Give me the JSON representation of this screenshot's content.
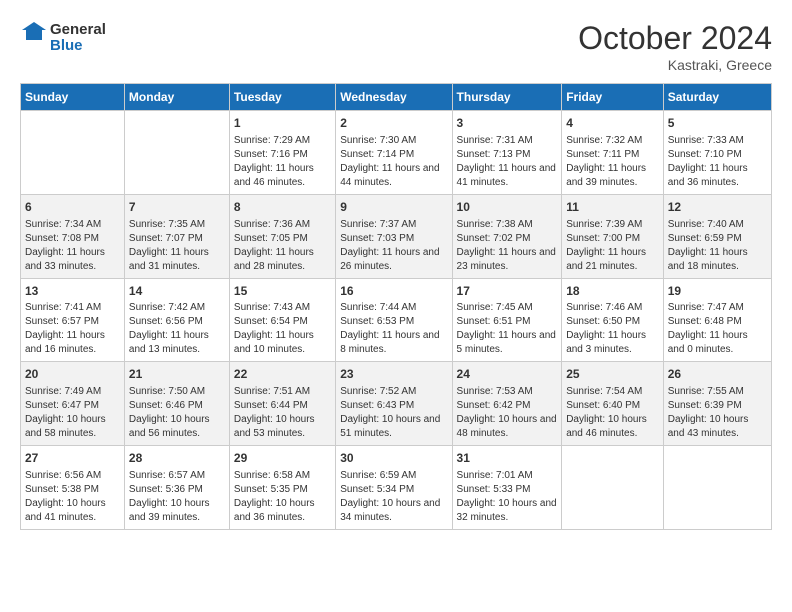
{
  "logo": {
    "line1": "General",
    "line2": "Blue"
  },
  "title": "October 2024",
  "location": "Kastraki, Greece",
  "days_of_week": [
    "Sunday",
    "Monday",
    "Tuesday",
    "Wednesday",
    "Thursday",
    "Friday",
    "Saturday"
  ],
  "weeks": [
    [
      {
        "day": "",
        "info": ""
      },
      {
        "day": "",
        "info": ""
      },
      {
        "day": "1",
        "info": "Sunrise: 7:29 AM\nSunset: 7:16 PM\nDaylight: 11 hours and 46 minutes."
      },
      {
        "day": "2",
        "info": "Sunrise: 7:30 AM\nSunset: 7:14 PM\nDaylight: 11 hours and 44 minutes."
      },
      {
        "day": "3",
        "info": "Sunrise: 7:31 AM\nSunset: 7:13 PM\nDaylight: 11 hours and 41 minutes."
      },
      {
        "day": "4",
        "info": "Sunrise: 7:32 AM\nSunset: 7:11 PM\nDaylight: 11 hours and 39 minutes."
      },
      {
        "day": "5",
        "info": "Sunrise: 7:33 AM\nSunset: 7:10 PM\nDaylight: 11 hours and 36 minutes."
      }
    ],
    [
      {
        "day": "6",
        "info": "Sunrise: 7:34 AM\nSunset: 7:08 PM\nDaylight: 11 hours and 33 minutes."
      },
      {
        "day": "7",
        "info": "Sunrise: 7:35 AM\nSunset: 7:07 PM\nDaylight: 11 hours and 31 minutes."
      },
      {
        "day": "8",
        "info": "Sunrise: 7:36 AM\nSunset: 7:05 PM\nDaylight: 11 hours and 28 minutes."
      },
      {
        "day": "9",
        "info": "Sunrise: 7:37 AM\nSunset: 7:03 PM\nDaylight: 11 hours and 26 minutes."
      },
      {
        "day": "10",
        "info": "Sunrise: 7:38 AM\nSunset: 7:02 PM\nDaylight: 11 hours and 23 minutes."
      },
      {
        "day": "11",
        "info": "Sunrise: 7:39 AM\nSunset: 7:00 PM\nDaylight: 11 hours and 21 minutes."
      },
      {
        "day": "12",
        "info": "Sunrise: 7:40 AM\nSunset: 6:59 PM\nDaylight: 11 hours and 18 minutes."
      }
    ],
    [
      {
        "day": "13",
        "info": "Sunrise: 7:41 AM\nSunset: 6:57 PM\nDaylight: 11 hours and 16 minutes."
      },
      {
        "day": "14",
        "info": "Sunrise: 7:42 AM\nSunset: 6:56 PM\nDaylight: 11 hours and 13 minutes."
      },
      {
        "day": "15",
        "info": "Sunrise: 7:43 AM\nSunset: 6:54 PM\nDaylight: 11 hours and 10 minutes."
      },
      {
        "day": "16",
        "info": "Sunrise: 7:44 AM\nSunset: 6:53 PM\nDaylight: 11 hours and 8 minutes."
      },
      {
        "day": "17",
        "info": "Sunrise: 7:45 AM\nSunset: 6:51 PM\nDaylight: 11 hours and 5 minutes."
      },
      {
        "day": "18",
        "info": "Sunrise: 7:46 AM\nSunset: 6:50 PM\nDaylight: 11 hours and 3 minutes."
      },
      {
        "day": "19",
        "info": "Sunrise: 7:47 AM\nSunset: 6:48 PM\nDaylight: 11 hours and 0 minutes."
      }
    ],
    [
      {
        "day": "20",
        "info": "Sunrise: 7:49 AM\nSunset: 6:47 PM\nDaylight: 10 hours and 58 minutes."
      },
      {
        "day": "21",
        "info": "Sunrise: 7:50 AM\nSunset: 6:46 PM\nDaylight: 10 hours and 56 minutes."
      },
      {
        "day": "22",
        "info": "Sunrise: 7:51 AM\nSunset: 6:44 PM\nDaylight: 10 hours and 53 minutes."
      },
      {
        "day": "23",
        "info": "Sunrise: 7:52 AM\nSunset: 6:43 PM\nDaylight: 10 hours and 51 minutes."
      },
      {
        "day": "24",
        "info": "Sunrise: 7:53 AM\nSunset: 6:42 PM\nDaylight: 10 hours and 48 minutes."
      },
      {
        "day": "25",
        "info": "Sunrise: 7:54 AM\nSunset: 6:40 PM\nDaylight: 10 hours and 46 minutes."
      },
      {
        "day": "26",
        "info": "Sunrise: 7:55 AM\nSunset: 6:39 PM\nDaylight: 10 hours and 43 minutes."
      }
    ],
    [
      {
        "day": "27",
        "info": "Sunrise: 6:56 AM\nSunset: 5:38 PM\nDaylight: 10 hours and 41 minutes."
      },
      {
        "day": "28",
        "info": "Sunrise: 6:57 AM\nSunset: 5:36 PM\nDaylight: 10 hours and 39 minutes."
      },
      {
        "day": "29",
        "info": "Sunrise: 6:58 AM\nSunset: 5:35 PM\nDaylight: 10 hours and 36 minutes."
      },
      {
        "day": "30",
        "info": "Sunrise: 6:59 AM\nSunset: 5:34 PM\nDaylight: 10 hours and 34 minutes."
      },
      {
        "day": "31",
        "info": "Sunrise: 7:01 AM\nSunset: 5:33 PM\nDaylight: 10 hours and 32 minutes."
      },
      {
        "day": "",
        "info": ""
      },
      {
        "day": "",
        "info": ""
      }
    ]
  ]
}
